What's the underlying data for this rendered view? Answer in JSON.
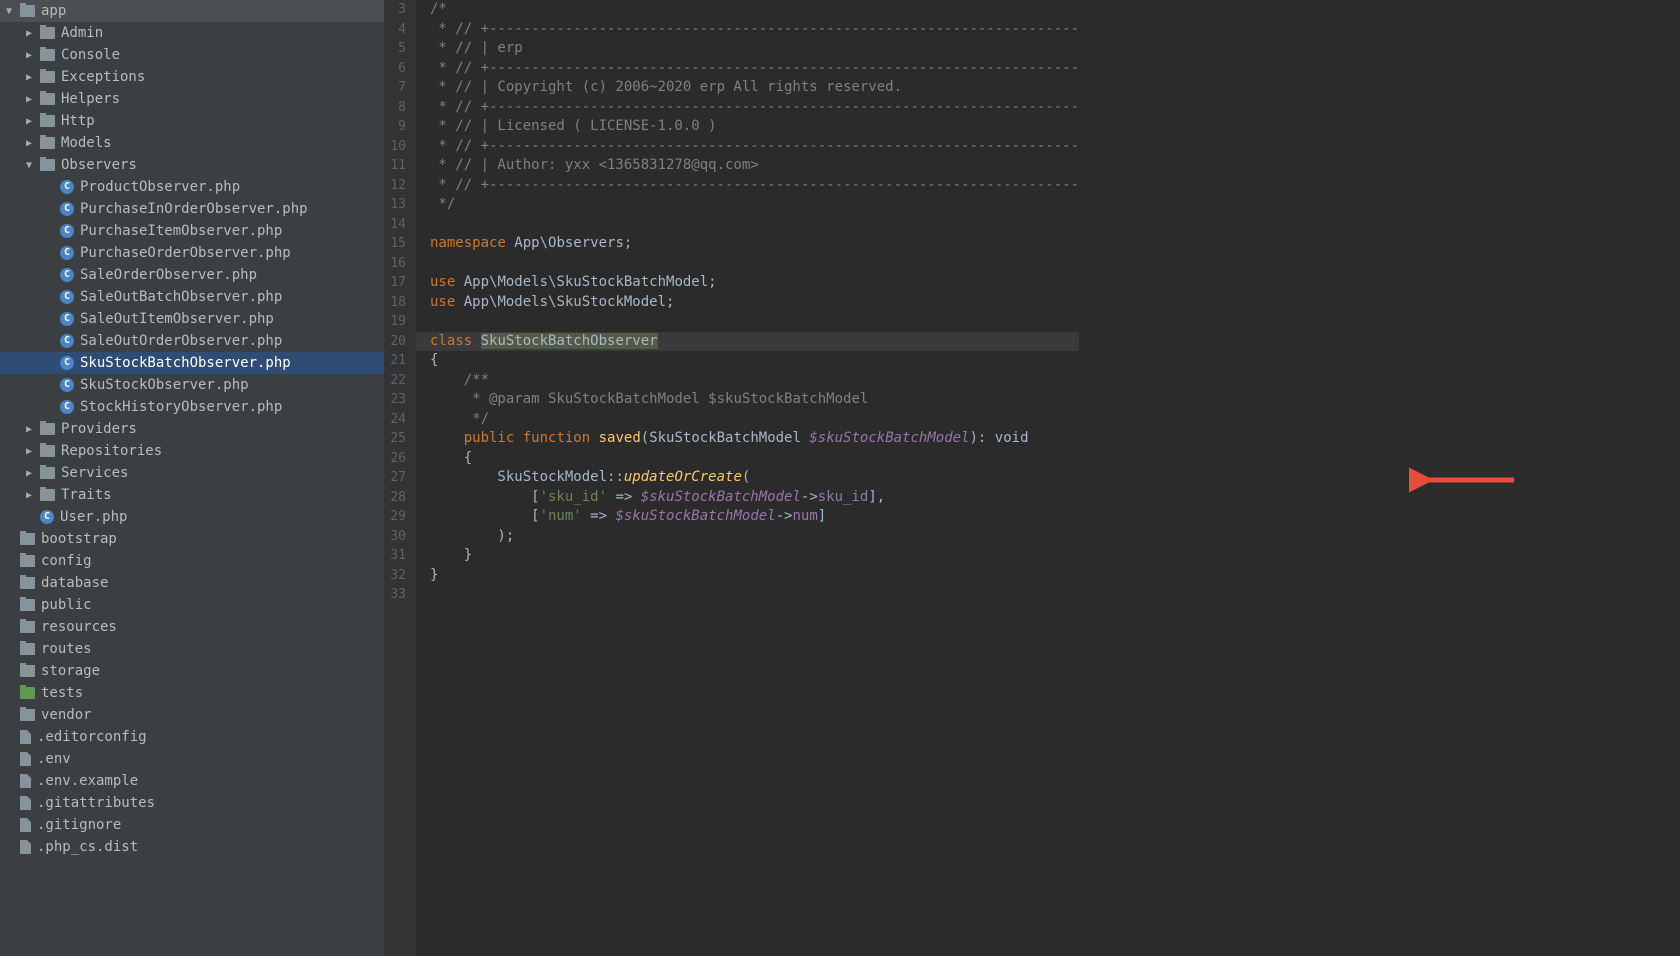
{
  "sidebar": {
    "tree": [
      {
        "indent": 0,
        "arrow": "down",
        "icon": "folder",
        "label": "app"
      },
      {
        "indent": 1,
        "arrow": "right",
        "icon": "folder",
        "label": "Admin"
      },
      {
        "indent": 1,
        "arrow": "right",
        "icon": "folder",
        "label": "Console"
      },
      {
        "indent": 1,
        "arrow": "right",
        "icon": "folder",
        "label": "Exceptions"
      },
      {
        "indent": 1,
        "arrow": "right",
        "icon": "folder",
        "label": "Helpers"
      },
      {
        "indent": 1,
        "arrow": "right",
        "icon": "folder",
        "label": "Http"
      },
      {
        "indent": 1,
        "arrow": "right",
        "icon": "folder",
        "label": "Models"
      },
      {
        "indent": 1,
        "arrow": "down",
        "icon": "folder",
        "label": "Observers"
      },
      {
        "indent": 2,
        "arrow": "none",
        "icon": "class",
        "label": "ProductObserver.php"
      },
      {
        "indent": 2,
        "arrow": "none",
        "icon": "class",
        "label": "PurchaseInOrderObserver.php"
      },
      {
        "indent": 2,
        "arrow": "none",
        "icon": "class",
        "label": "PurchaseItemObserver.php"
      },
      {
        "indent": 2,
        "arrow": "none",
        "icon": "class",
        "label": "PurchaseOrderObserver.php"
      },
      {
        "indent": 2,
        "arrow": "none",
        "icon": "class",
        "label": "SaleOrderObserver.php"
      },
      {
        "indent": 2,
        "arrow": "none",
        "icon": "class",
        "label": "SaleOutBatchObserver.php"
      },
      {
        "indent": 2,
        "arrow": "none",
        "icon": "class",
        "label": "SaleOutItemObserver.php"
      },
      {
        "indent": 2,
        "arrow": "none",
        "icon": "class",
        "label": "SaleOutOrderObserver.php"
      },
      {
        "indent": 2,
        "arrow": "none",
        "icon": "class",
        "label": "SkuStockBatchObserver.php",
        "selected": true
      },
      {
        "indent": 2,
        "arrow": "none",
        "icon": "class",
        "label": "SkuStockObserver.php"
      },
      {
        "indent": 2,
        "arrow": "none",
        "icon": "class",
        "label": "StockHistoryObserver.php"
      },
      {
        "indent": 1,
        "arrow": "right",
        "icon": "folder",
        "label": "Providers"
      },
      {
        "indent": 1,
        "arrow": "right",
        "icon": "folder",
        "label": "Repositories"
      },
      {
        "indent": 1,
        "arrow": "right",
        "icon": "folder",
        "label": "Services"
      },
      {
        "indent": 1,
        "arrow": "right",
        "icon": "folder",
        "label": "Traits"
      },
      {
        "indent": 1,
        "arrow": "none",
        "icon": "class",
        "label": "User.php"
      },
      {
        "indent": 0,
        "arrow": "none",
        "icon": "folder",
        "label": "bootstrap"
      },
      {
        "indent": 0,
        "arrow": "none",
        "icon": "folder",
        "label": "config"
      },
      {
        "indent": 0,
        "arrow": "none",
        "icon": "folder",
        "label": "database"
      },
      {
        "indent": 0,
        "arrow": "none",
        "icon": "folder",
        "label": "public"
      },
      {
        "indent": 0,
        "arrow": "none",
        "icon": "folder",
        "label": "resources"
      },
      {
        "indent": 0,
        "arrow": "none",
        "icon": "folder",
        "label": "routes"
      },
      {
        "indent": 0,
        "arrow": "none",
        "icon": "folder",
        "label": "storage"
      },
      {
        "indent": 0,
        "arrow": "none",
        "icon": "folder green",
        "label": "tests"
      },
      {
        "indent": 0,
        "arrow": "none",
        "icon": "folder",
        "label": "vendor"
      },
      {
        "indent": 0,
        "arrow": "none",
        "icon": "file",
        "label": ".editorconfig"
      },
      {
        "indent": 0,
        "arrow": "none",
        "icon": "file",
        "label": ".env"
      },
      {
        "indent": 0,
        "arrow": "none",
        "icon": "file",
        "label": ".env.example"
      },
      {
        "indent": 0,
        "arrow": "none",
        "icon": "file",
        "label": ".gitattributes"
      },
      {
        "indent": 0,
        "arrow": "none",
        "icon": "file",
        "label": ".gitignore"
      },
      {
        "indent": 0,
        "arrow": "none",
        "icon": "file",
        "label": ".php_cs.dist"
      }
    ]
  },
  "editor": {
    "gutterStart": 3,
    "gutterEnd": 33,
    "highlightLine": 20,
    "lines": {
      "3": [
        {
          "c": "tk-comment",
          "t": "/*"
        }
      ],
      "4": [
        {
          "c": "tk-comment",
          "t": " * // +----------------------------------------------------------------------"
        }
      ],
      "5": [
        {
          "c": "tk-comment",
          "t": " * // | erp"
        }
      ],
      "6": [
        {
          "c": "tk-comment",
          "t": " * // +----------------------------------------------------------------------"
        }
      ],
      "7": [
        {
          "c": "tk-comment",
          "t": " * // | Copyright (c) 2006~2020 erp All rights reserved."
        }
      ],
      "8": [
        {
          "c": "tk-comment",
          "t": " * // +----------------------------------------------------------------------"
        }
      ],
      "9": [
        {
          "c": "tk-comment",
          "t": " * // | Licensed ( LICENSE-1.0.0 )"
        }
      ],
      "10": [
        {
          "c": "tk-comment",
          "t": " * // +----------------------------------------------------------------------"
        }
      ],
      "11": [
        {
          "c": "tk-comment",
          "t": " * // | Author: yxx <1365831278@qq.com>"
        }
      ],
      "12": [
        {
          "c": "tk-comment",
          "t": " * // +----------------------------------------------------------------------"
        }
      ],
      "13": [
        {
          "c": "tk-comment",
          "t": " */"
        }
      ],
      "14": [],
      "15": [
        {
          "c": "tk-keyword",
          "t": "namespace"
        },
        {
          "c": "tk-punc",
          "t": " "
        },
        {
          "c": "tk-ns",
          "t": "App\\Observers"
        },
        {
          "c": "tk-punc",
          "t": ";"
        }
      ],
      "16": [],
      "17": [
        {
          "c": "tk-keyword",
          "t": "use"
        },
        {
          "c": "tk-punc",
          "t": " "
        },
        {
          "c": "tk-ns",
          "t": "App\\Models\\SkuStockBatchModel"
        },
        {
          "c": "tk-punc",
          "t": ";"
        }
      ],
      "18": [
        {
          "c": "tk-keyword",
          "t": "use"
        },
        {
          "c": "tk-punc",
          "t": " "
        },
        {
          "c": "tk-ns",
          "t": "App\\Models\\SkuStockModel"
        },
        {
          "c": "tk-punc",
          "t": ";"
        }
      ],
      "19": [],
      "20": [
        {
          "c": "tk-keyword",
          "t": "class"
        },
        {
          "c": "tk-punc",
          "t": " "
        },
        {
          "c": "tk-class class-hl",
          "t": "SkuStockBatchObserver"
        }
      ],
      "21": [
        {
          "c": "tk-punc",
          "t": "{"
        }
      ],
      "22": [
        {
          "c": "tk-punc",
          "t": "    "
        },
        {
          "c": "tk-comment",
          "t": "/**"
        }
      ],
      "23": [
        {
          "c": "tk-punc",
          "t": "    "
        },
        {
          "c": "tk-comment",
          "t": " * @param SkuStockBatchModel $skuStockBatchModel"
        }
      ],
      "24": [
        {
          "c": "tk-punc",
          "t": "    "
        },
        {
          "c": "tk-comment",
          "t": " */"
        }
      ],
      "25": [
        {
          "c": "tk-punc",
          "t": "    "
        },
        {
          "c": "tk-keyword",
          "t": "public"
        },
        {
          "c": "tk-punc",
          "t": " "
        },
        {
          "c": "tk-keyword",
          "t": "function"
        },
        {
          "c": "tk-punc",
          "t": " "
        },
        {
          "c": "tk-method",
          "t": "saved"
        },
        {
          "c": "tk-punc",
          "t": "(SkuStockBatchModel "
        },
        {
          "c": "tk-var",
          "t": "$skuStockBatchModel"
        },
        {
          "c": "tk-punc",
          "t": "): "
        },
        {
          "c": "tk-type",
          "t": "void"
        }
      ],
      "26": [
        {
          "c": "tk-punc",
          "t": "    {"
        }
      ],
      "27": [
        {
          "c": "tk-punc",
          "t": "        SkuStockModel"
        },
        {
          "c": "tk-punc",
          "t": "::"
        },
        {
          "c": "tk-method2",
          "t": "updateOrCreate"
        },
        {
          "c": "tk-punc",
          "t": "("
        }
      ],
      "28": [
        {
          "c": "tk-punc",
          "t": "            ["
        },
        {
          "c": "tk-string",
          "t": "'sku_id'"
        },
        {
          "c": "tk-punc",
          "t": " => "
        },
        {
          "c": "tk-var",
          "t": "$skuStockBatchModel"
        },
        {
          "c": "tk-arrow",
          "t": "->"
        },
        {
          "c": "tk-prop",
          "t": "sku_id"
        },
        {
          "c": "tk-punc",
          "t": "],"
        }
      ],
      "29": [
        {
          "c": "tk-punc",
          "t": "            ["
        },
        {
          "c": "tk-string",
          "t": "'num'"
        },
        {
          "c": "tk-punc",
          "t": " => "
        },
        {
          "c": "tk-var",
          "t": "$skuStockBatchModel"
        },
        {
          "c": "tk-arrow",
          "t": "->"
        },
        {
          "c": "tk-prop",
          "t": "num"
        },
        {
          "c": "tk-punc",
          "t": "]"
        }
      ],
      "30": [
        {
          "c": "tk-punc",
          "t": "        );"
        }
      ],
      "31": [
        {
          "c": "tk-punc",
          "t": "    }"
        }
      ],
      "32": [
        {
          "c": "tk-punc",
          "t": "}"
        }
      ],
      "33": []
    }
  }
}
